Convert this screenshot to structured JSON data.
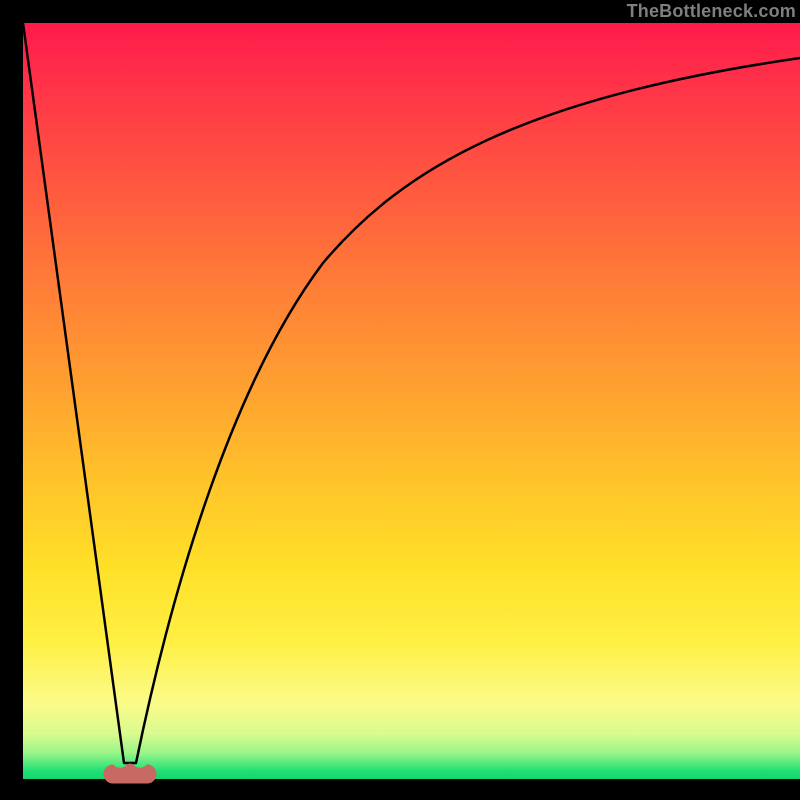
{
  "watermark": "TheBottleneck.com",
  "colors": {
    "frame": "#000000",
    "watermark_text": "#7f7f7f",
    "curve": "#000000",
    "marker": "#c86a63",
    "gradient_top": "#ff1a4b",
    "gradient_mid": "#ffe028",
    "gradient_bottom": "#14d66d"
  },
  "chart_data": {
    "type": "line",
    "title": "",
    "xlabel": "",
    "ylabel": "",
    "xlim": [
      0,
      100
    ],
    "ylim": [
      0,
      100
    ],
    "grid": false,
    "legend": false,
    "description": "V-shaped bottleneck curve on vertical red→yellow→green heat gradient. Steep linear drop from top-left to a minimum near x≈13, then a decelerating rise approaching the top-right.",
    "series": [
      {
        "name": "bottleneck-curve",
        "x": [
          0,
          2,
          4,
          6,
          8,
          10,
          11,
          12,
          13,
          14,
          15,
          16,
          18,
          20,
          22,
          25,
          28,
          32,
          36,
          40,
          45,
          50,
          55,
          60,
          65,
          70,
          75,
          80,
          85,
          90,
          95,
          100
        ],
        "y": [
          100,
          85,
          70,
          55,
          40,
          24,
          16,
          8,
          2,
          3,
          8,
          14,
          24,
          33,
          41,
          51,
          58,
          66,
          72,
          76,
          80.5,
          84,
          86.5,
          88.5,
          90,
          91.3,
          92.3,
          93.2,
          93.9,
          94.5,
          95,
          95.5
        ]
      }
    ],
    "marker": {
      "name": "bottleneck-minimum",
      "x_range": [
        11.3,
        14.7
      ],
      "y": 2,
      "shape": "rounded-bean"
    },
    "background_bands_y": [
      {
        "color": "red-orange",
        "from": 10,
        "to": 100
      },
      {
        "color": "yellow",
        "from": 4,
        "to": 10
      },
      {
        "color": "green",
        "from": 0,
        "to": 4
      }
    ]
  }
}
